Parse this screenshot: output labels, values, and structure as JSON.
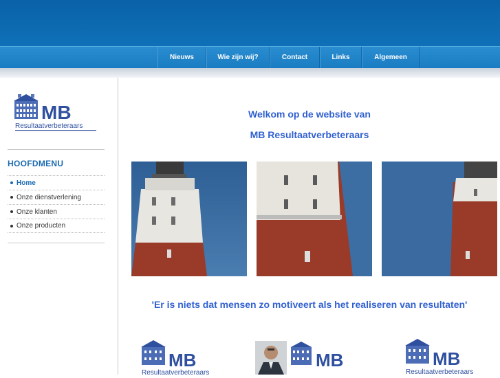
{
  "nav": {
    "items": [
      "Nieuws",
      "Wie zijn wij?",
      "Contact",
      "Links",
      "Algemeen"
    ]
  },
  "logo": {
    "initials": "MB",
    "tagline": "Resultaatverbeteraars"
  },
  "sidebar": {
    "title": "HOOFDMENU",
    "items": [
      "Home",
      "Onze dienstverlening",
      "Onze klanten",
      "Onze producten"
    ],
    "active": "Home"
  },
  "content": {
    "welcome_line1": "Welkom op de website van",
    "welcome_line2": "MB Resultaatverbeteraars",
    "quote": "'Er is niets dat mensen zo motiveert als het realiseren van resultaten'"
  },
  "colors": {
    "header": "#0f70b8",
    "accent": "#3060d0",
    "menu_accent": "#1a6ab0"
  }
}
